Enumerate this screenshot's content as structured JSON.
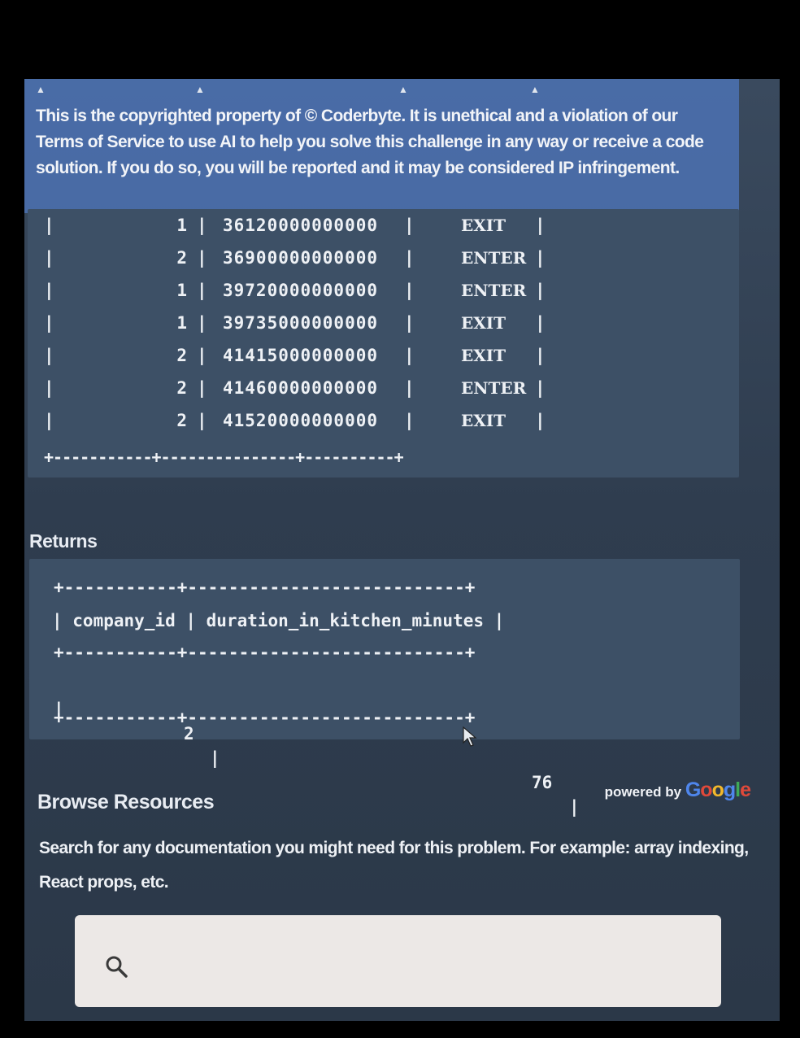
{
  "notice": {
    "text": "This is the copyrighted property of © Coderbyte. It is unethical and a violation of our Terms of Service to use AI to help you solve this challenge in any way or receive a code solution. If you do so, you will be reported and it may be considered IP infringement."
  },
  "input_table": {
    "rows": [
      {
        "company_id": "1",
        "timestamp": "36120000000000",
        "action": "EXIT"
      },
      {
        "company_id": "2",
        "timestamp": "36900000000000",
        "action": "ENTER"
      },
      {
        "company_id": "1",
        "timestamp": "39720000000000",
        "action": "ENTER"
      },
      {
        "company_id": "1",
        "timestamp": "39735000000000",
        "action": "EXIT"
      },
      {
        "company_id": "2",
        "timestamp": "41415000000000",
        "action": "EXIT"
      },
      {
        "company_id": "2",
        "timestamp": "41460000000000",
        "action": "ENTER"
      },
      {
        "company_id": "2",
        "timestamp": "41520000000000",
        "action": "EXIT"
      }
    ],
    "bottom_border": "+-----------+---------------+----------+"
  },
  "returns": {
    "label": "Returns",
    "border": "+-----------+---------------------------+",
    "header": "| company_id | duration_in_kitchen_minutes |",
    "row": {
      "company_id": "2",
      "duration": "76"
    }
  },
  "resources": {
    "title": "Browse Resources",
    "powered_by": "powered by",
    "google_letters": [
      "G",
      "o",
      "o",
      "g",
      "l",
      "e"
    ],
    "description": "Search for any documentation you might need for this problem. For example: array indexing, React props, etc.",
    "search_placeholder": "",
    "search_icon": "search-icon"
  }
}
